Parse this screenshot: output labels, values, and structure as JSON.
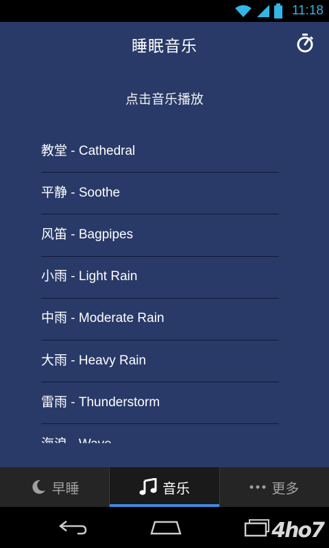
{
  "status": {
    "time": "11:18",
    "time_color": "#33b5e5"
  },
  "header": {
    "title": "睡眠音乐",
    "timer_icon": "stopwatch-icon"
  },
  "subtitle": "点击音乐播放",
  "list": {
    "items": [
      {
        "label": "教堂 - Cathedral"
      },
      {
        "label": "平静 - Soothe"
      },
      {
        "label": "风笛 - Bagpipes"
      },
      {
        "label": "小雨 - Light Rain"
      },
      {
        "label": "中雨 - Moderate Rain"
      },
      {
        "label": "大雨 - Heavy Rain"
      },
      {
        "label": "雷雨 - Thunderstorm"
      },
      {
        "label": "海浪 - Wave"
      }
    ]
  },
  "tabs": [
    {
      "label": "早睡",
      "icon": "moon-icon"
    },
    {
      "label": "音乐",
      "icon": "music-note-icon",
      "active": true
    },
    {
      "label": "更多",
      "icon": "more-dots-icon"
    }
  ],
  "colors": {
    "background": "#293a68",
    "tab_indicator": "#3c8de0"
  },
  "watermark": "4ho7"
}
